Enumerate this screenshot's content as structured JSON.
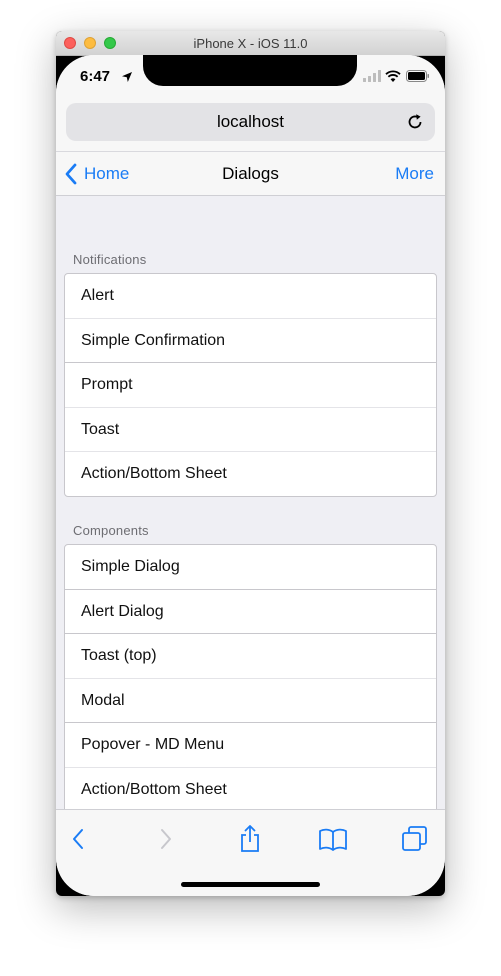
{
  "window": {
    "title": "iPhone X - iOS 11.0"
  },
  "status_bar": {
    "time": "6:47"
  },
  "browser": {
    "url": "localhost"
  },
  "nav": {
    "back_label": "Home",
    "title": "Dialogs",
    "action_label": "More"
  },
  "sections": [
    {
      "header": "Notifications",
      "items": [
        "Alert",
        "Simple Confirmation",
        "Prompt",
        "Toast",
        "Action/Bottom Sheet"
      ]
    },
    {
      "header": "Components",
      "items": [
        "Simple Dialog",
        "Alert Dialog",
        "Toast (top)",
        "Modal",
        "Popover - MD Menu",
        "Action/Bottom Sheet"
      ]
    }
  ],
  "colors": {
    "accent": "#1a7cf5",
    "background": "#efeff4"
  },
  "toolbar": {
    "icons": [
      "back-icon",
      "forward-icon",
      "share-icon",
      "bookmarks-icon",
      "tabs-icon"
    ]
  }
}
